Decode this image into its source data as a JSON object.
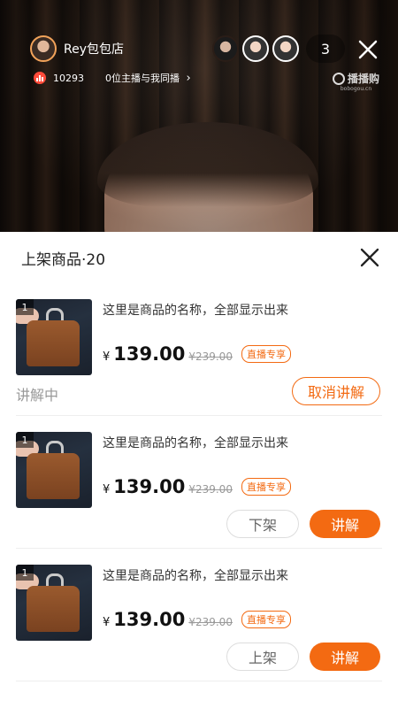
{
  "live": {
    "host_name": "Rey包包店",
    "likes": "10293",
    "cohost_text": "0位主播与我同播",
    "viewer_count": "3",
    "watermark": {
      "name": "播播购",
      "url": "bobogou.cn"
    }
  },
  "sheet": {
    "title": "上架商品·20"
  },
  "products": [
    {
      "rank": "1",
      "name": "这里是商品的名称，全部显示出来",
      "currency": "¥",
      "price": "139.00",
      "original_price": "¥239.00",
      "badge": "直播专享",
      "status": "讲解中",
      "action_label": "取消讲解"
    },
    {
      "rank": "1",
      "name": "这里是商品的名称，全部显示出来",
      "currency": "¥",
      "price": "139.00",
      "original_price": "¥239.00",
      "badge": "直播专享",
      "secondary_label": "下架",
      "primary_label": "讲解"
    },
    {
      "rank": "1",
      "name": "这里是商品的名称，全部显示出来",
      "currency": "¥",
      "price": "139.00",
      "original_price": "¥239.00",
      "badge": "直播专享",
      "secondary_label": "上架",
      "primary_label": "讲解"
    }
  ],
  "colors": {
    "accent": "#f36a12",
    "like_icon": "#ff4b3a"
  },
  "icons": [
    "close-icon",
    "chevron-right-icon",
    "like-stats-icon",
    "watermark-logo-icon"
  ]
}
